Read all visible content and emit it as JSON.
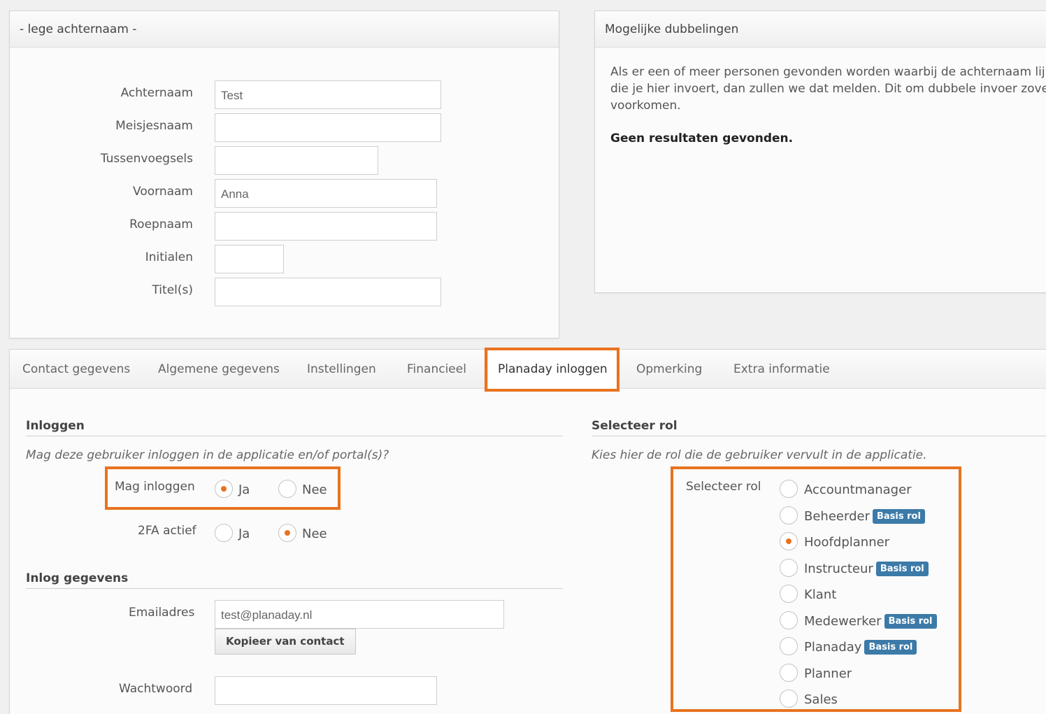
{
  "name_panel": {
    "title": "- lege achternaam -",
    "fields": [
      {
        "label": "Achternaam",
        "value": "Test"
      },
      {
        "label": "Meisjesnaam",
        "value": ""
      },
      {
        "label": "Tussenvoegsels",
        "value": ""
      },
      {
        "label": "Voornaam",
        "value": "Anna"
      },
      {
        "label": "Roepnaam",
        "value": ""
      },
      {
        "label": "Initialen",
        "value": ""
      },
      {
        "label": "Titel(s)",
        "value": ""
      }
    ]
  },
  "duplicates_panel": {
    "title": "Mogelijke dubbelingen",
    "text_lines": [
      "Als er een of meer personen gevonden worden waarbij de achternaam lijkt",
      "die je hier invoert, dan zullen we dat melden. Dit om dubbele invoer zoveel",
      "voorkomen."
    ],
    "result": "Geen resultaten gevonden."
  },
  "tabs": [
    {
      "label": "Contact gegevens",
      "active": false
    },
    {
      "label": "Algemene gegevens",
      "active": false
    },
    {
      "label": "Instellingen",
      "active": false
    },
    {
      "label": "Financieel",
      "active": false
    },
    {
      "label": "Planaday inloggen",
      "active": true
    },
    {
      "label": "Opmerking",
      "active": false
    },
    {
      "label": "Extra informatie",
      "active": false
    }
  ],
  "login_section": {
    "title": "Inloggen",
    "description": "Mag deze gebruiker inloggen in de applicatie en/of portal(s)?",
    "may_login": {
      "label": "Mag inloggen",
      "options": [
        "Ja",
        "Nee"
      ],
      "selected": "Ja"
    },
    "twofa": {
      "label": "2FA actief",
      "options": [
        "Ja",
        "Nee"
      ],
      "selected": "Nee"
    }
  },
  "credentials_section": {
    "title": "Inlog gegevens",
    "email_label": "Emailadres",
    "email_value": "test@planaday.nl",
    "copy_button": "Kopieer van contact",
    "password_label": "Wachtwoord",
    "password_value": ""
  },
  "role_section": {
    "title": "Selecteer rol",
    "description": "Kies hier de rol die de gebruiker vervult in de applicatie.",
    "field_label": "Selecteer rol",
    "badge_text": "Basis rol",
    "selected": "Hoofdplanner",
    "roles": [
      {
        "name": "Accountmanager",
        "basis": false
      },
      {
        "name": "Beheerder",
        "basis": true
      },
      {
        "name": "Hoofdplanner",
        "basis": false
      },
      {
        "name": "Instructeur",
        "basis": true
      },
      {
        "name": "Klant",
        "basis": false
      },
      {
        "name": "Medewerker",
        "basis": true
      },
      {
        "name": "Planaday",
        "basis": true
      },
      {
        "name": "Planner",
        "basis": false
      },
      {
        "name": "Sales",
        "basis": false
      }
    ]
  },
  "colors": {
    "accent": "#e8731f",
    "badge": "#3c7aa8"
  }
}
